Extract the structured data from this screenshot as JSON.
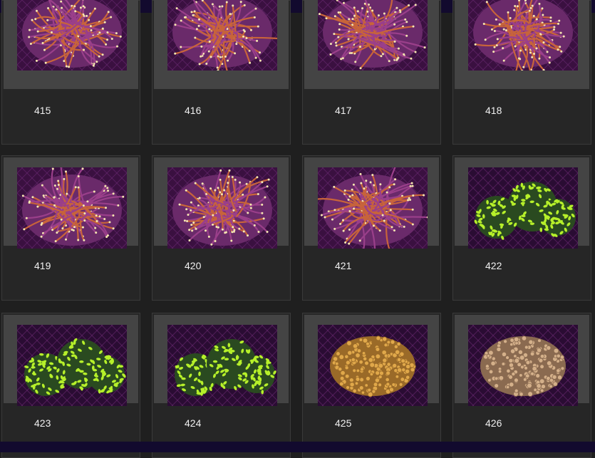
{
  "colors": {
    "background": "#1f1f1f",
    "frame": "#444444",
    "bar": "#120a2e",
    "text": "#f0f0f0"
  },
  "grid": {
    "items": [
      {
        "number": "415",
        "coral": "torch-purple"
      },
      {
        "number": "416",
        "coral": "torch-purple"
      },
      {
        "number": "417",
        "coral": "torch-purple"
      },
      {
        "number": "418",
        "coral": "torch-purple"
      },
      {
        "number": "419",
        "coral": "torch-purple"
      },
      {
        "number": "420",
        "coral": "torch-purple"
      },
      {
        "number": "421",
        "coral": "torch-purple"
      },
      {
        "number": "422",
        "coral": "hammer-green"
      },
      {
        "number": "423",
        "coral": "hammer-green"
      },
      {
        "number": "424",
        "coral": "hammer-green"
      },
      {
        "number": "425",
        "coral": "frogspawn-gold"
      },
      {
        "number": "426",
        "coral": "frogspawn-tan"
      }
    ]
  }
}
